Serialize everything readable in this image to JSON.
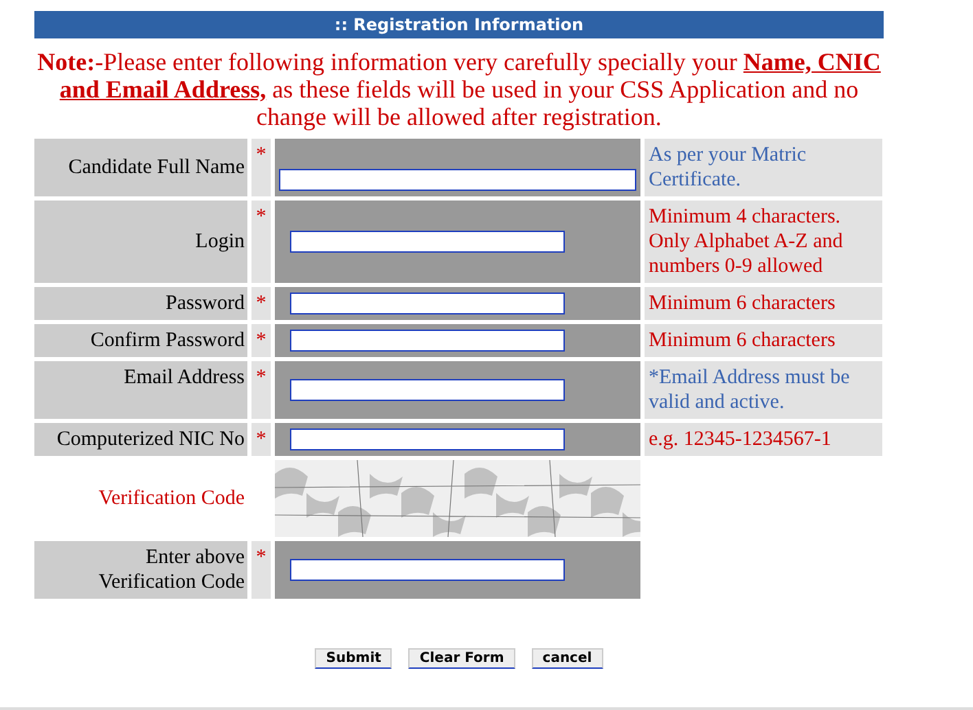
{
  "header": {
    "title": ":: Registration Information"
  },
  "note": "**Note:**-Please enter following information very carefully specially your **Name, CNIC and Email Address,** as these fields will be used in your CSS Application and no change will be allowed after registration.",
  "rows": [
    {
      "kind": "field",
      "label": "Candidate Full Name",
      "required": "*",
      "hint": "As per your Matric Certificate.",
      "color": "#3a64b0"
    },
    {
      "kind": "field",
      "label": "Login",
      "required": "*",
      "hint": "Minimum 4 characters. Only Alphabet A-Z and numbers 0-9 allowed",
      "color": "#cc0000"
    },
    {
      "kind": "field",
      "label": "Password",
      "required": "*",
      "hint": "Minimum 6 characters",
      "color": "#cc0000"
    },
    {
      "kind": "field",
      "label": "Confirm Password",
      "required": "*",
      "hint": "Minimum 6 characters",
      "color": "#cc0000"
    },
    {
      "kind": "field",
      "label": "Email Address",
      "required": "*",
      "hint": "*Email Address must be valid and active.",
      "color": "#3a64b0"
    },
    {
      "kind": "field",
      "label": "Computerized NIC No",
      "required": "*",
      "hint": "e.g. 12345-1234567-1",
      "color": "#cc0000"
    },
    {
      "kind": "captcha",
      "label": "Verification Code"
    },
    {
      "kind": "field",
      "label": "Enter above Verification Code",
      "required": "*"
    }
  ],
  "buttons": [
    "Submit",
    "Clear Form",
    "cancel"
  ]
}
